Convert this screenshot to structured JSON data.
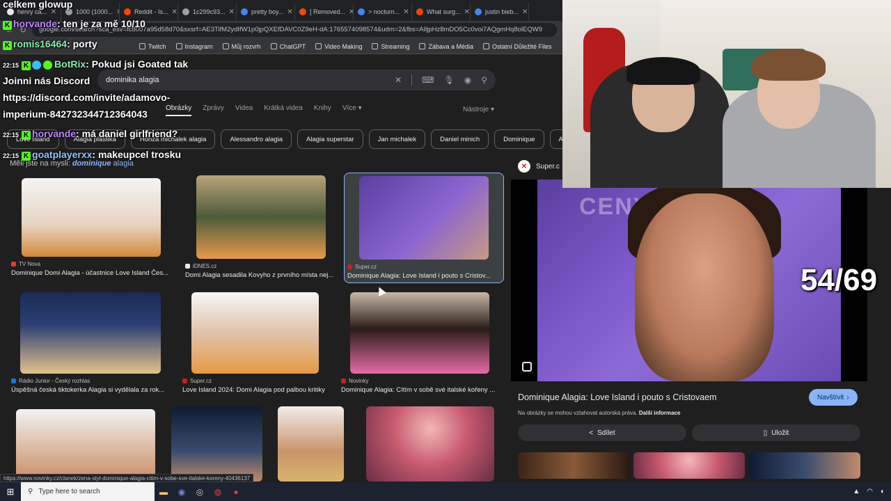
{
  "browser": {
    "tabs": [
      {
        "label": "henry ca..."
      },
      {
        "label": "1000 (1000..."
      },
      {
        "label": "Reddit - Is..."
      },
      {
        "label": "1c299c93..."
      },
      {
        "label": "pretty boy..."
      },
      {
        "label": "[ Removed..."
      },
      {
        "label": "> nocturn..."
      },
      {
        "label": "What surg..."
      },
      {
        "label": "justin bieb..."
      }
    ],
    "url": "google.com/search?sca_esv=fc8007a95d58d70&sxsrf=AE3TifM2ydIfW1p0jpQXEfDAVC0Z9eH-dA:1765574098574&udm=2&fbs=AIljpHz8mDO5Cc0voi7AQgmHq8olEQW9",
    "bookmarks": [
      "Twitch",
      "Instagram",
      "Můj rozvrh",
      "ChatGPT",
      "Video Making",
      "Streaming",
      "Zábava a Média",
      "Ostatní Důležité Files"
    ]
  },
  "search": {
    "query": "dominika alagia",
    "tabs": [
      "Obrázky",
      "Zprávy",
      "Videa",
      "Krátká videa",
      "Knihy",
      "Více"
    ],
    "more_arrow": "▾",
    "tools": "Nástroje ▾",
    "chips": [
      "Love Island",
      "Alagia plastika",
      "Honza michalek alagia",
      "Alessandro alagia",
      "Alagia superstar",
      "Jan michalek",
      "Daniel minich",
      "Dominique",
      "Alagia"
    ],
    "suggest_prefix": "Měli jste na mysli:",
    "suggest_bold": "dominique",
    "suggest_rest": "alagia"
  },
  "results": [
    {
      "source": "TV Nova",
      "title": "Dominique Domi Alagia - účastnice Love Island Čes..."
    },
    {
      "source": "iDNES.cz",
      "title": "Domi Alagia sesadila Kovyho z prvního místa nej..."
    },
    {
      "source": "Super.cz",
      "title": "Dominique Alagia: Love Island i pouto s Cristov..."
    },
    {
      "source": "Rádio Junior - Český rozhlas",
      "title": "Úspěšná česká tiktokerka Alagia si vydělala za rok..."
    },
    {
      "source": "Super.cz",
      "title": "Love Island 2024: Domi Alagia pod palbou kritiky"
    },
    {
      "source": "Novinky",
      "title": "Dominique Alagia: Cítím v sobě své italské kořeny ..."
    }
  ],
  "preview": {
    "source": "Super.c",
    "logo": "✕",
    "watermark": "CENY ANDE",
    "title": "Dominique Alagia: Love Island i pouto s Cristovaem",
    "visit": "Navštívit",
    "rights_text": "Na obrázky se mohou vztahovat autorská práva.",
    "rights_link": "Další informace",
    "share": "Sdílet",
    "save": "Uložit"
  },
  "overlay": {
    "counter": "54/69"
  },
  "chat": [
    {
      "time": "",
      "user": "celkem glowup",
      "message": "",
      "color": "#ffffff"
    },
    {
      "time": "",
      "user": "horvande",
      "message": ": ten je za mě 10/10",
      "color": "#c084fc"
    },
    {
      "time": "",
      "user": "romis16464",
      "message": ": porty",
      "color": "#86efac"
    },
    {
      "time": "22:15",
      "user": "BotRix",
      "message": ": Pokud jsi Goated tak",
      "color": "#86efac"
    },
    {
      "time": "",
      "user": "",
      "message": "Joinni nás Discord",
      "color": "#ffffff"
    },
    {
      "time": "",
      "user": "",
      "message": "https://discord.com/invite/adamovo-",
      "color": "#ffffff"
    },
    {
      "time": "",
      "user": "",
      "message": "imperium-842732344712364043",
      "color": "#ffffff"
    },
    {
      "time": "22:15",
      "user": "horvande",
      "message": ": má daniel girlfriend?",
      "color": "#c084fc"
    },
    {
      "time": "22:15",
      "user": "goatplayerxx",
      "message": ": makeupcel trosku",
      "color": "#93c5fd"
    }
  ],
  "status_url": "https://www.novinky.cz/clanek/zena-styl-dominique-alagia-citim-v-sobe-sve-italske-koreny-40436137",
  "taskbar": {
    "search_placeholder": "Type here to search"
  },
  "colors": {
    "accent": "#8ab4f8",
    "page_bg": "#1f1f1f",
    "kick_green": "#53fc18"
  }
}
